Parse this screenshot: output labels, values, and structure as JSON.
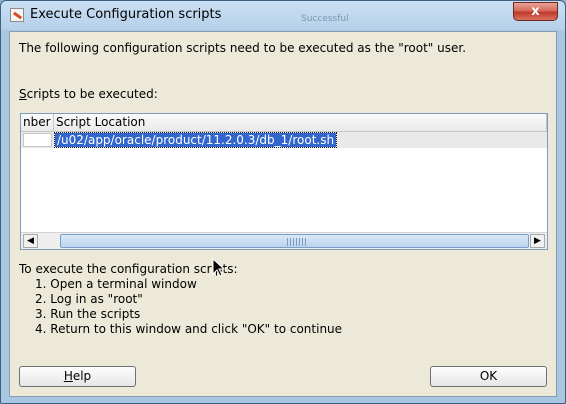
{
  "window": {
    "title": "Execute Configuration scripts",
    "ghost_text": "Successful",
    "close_glyph": "x"
  },
  "dialog": {
    "intro": "The following configuration scripts need to be executed as the \"root\" user.",
    "scripts_label_underlined": "S",
    "scripts_label_rest": "cripts to be executed:",
    "table": {
      "columns": [
        "nber",
        "Script Location"
      ],
      "rows": [
        {
          "number": "",
          "location": "/u02/app/oracle/product/11.2.0.3/db_1/root.sh"
        }
      ]
    },
    "instructions_heading": "To execute the configuration scripts:",
    "steps": [
      "1. Open a terminal window",
      "2. Log in as \"root\"",
      "3. Run the scripts",
      "4. Return to this window and click \"OK\" to continue"
    ]
  },
  "buttons": {
    "help_underlined": "H",
    "help_rest": "elp",
    "ok": "OK"
  }
}
